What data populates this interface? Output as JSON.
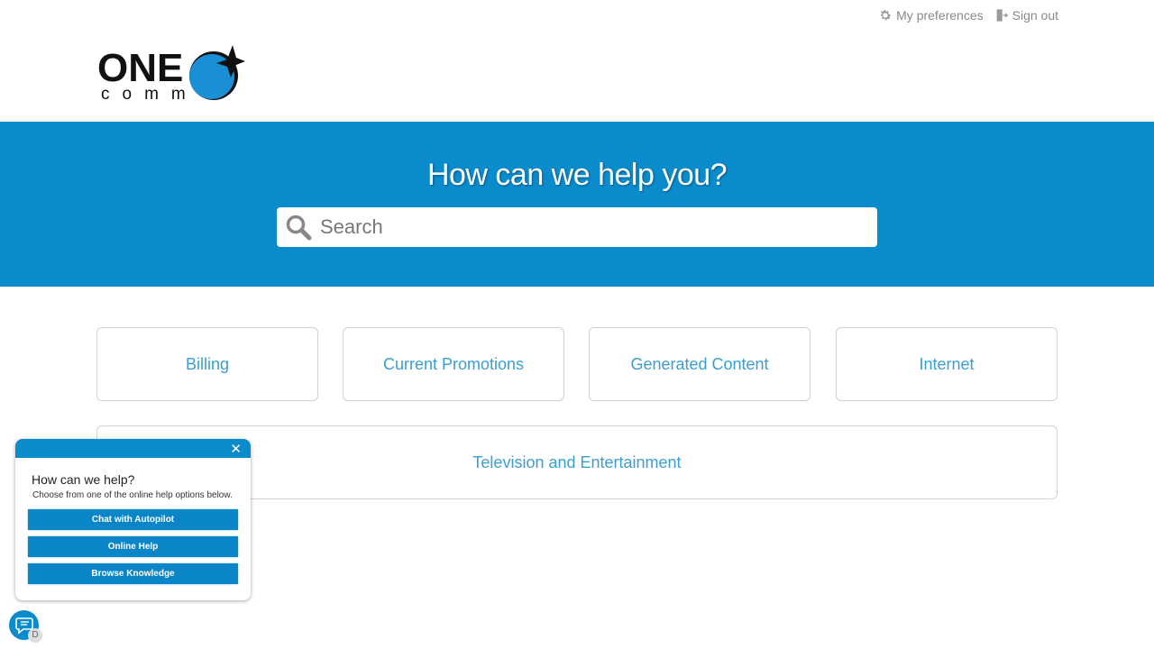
{
  "header": {
    "preferences_label": "My preferences",
    "signout_label": "Sign out",
    "logo": {
      "word1": "ONE",
      "word2": "comm",
      "accent": "#0a8bcc"
    }
  },
  "hero": {
    "title": "How can we help you?",
    "search_placeholder": "Search",
    "search_value": "",
    "background": "#0a8bcc"
  },
  "categories": [
    {
      "label": "Billing"
    },
    {
      "label": "Current Promotions"
    },
    {
      "label": "Generated Content"
    },
    {
      "label": "Internet"
    },
    {
      "label": "Television and Entertainment"
    }
  ],
  "help_widget": {
    "title": "How can we help?",
    "subtitle": "Choose from one of the online help options below.",
    "close_glyph": "✕",
    "buttons": [
      {
        "label": "Chat with Autopilot"
      },
      {
        "label": "Online Help"
      },
      {
        "label": "Browse Knowledge"
      }
    ]
  },
  "chat_fab": {
    "badge": "D"
  }
}
